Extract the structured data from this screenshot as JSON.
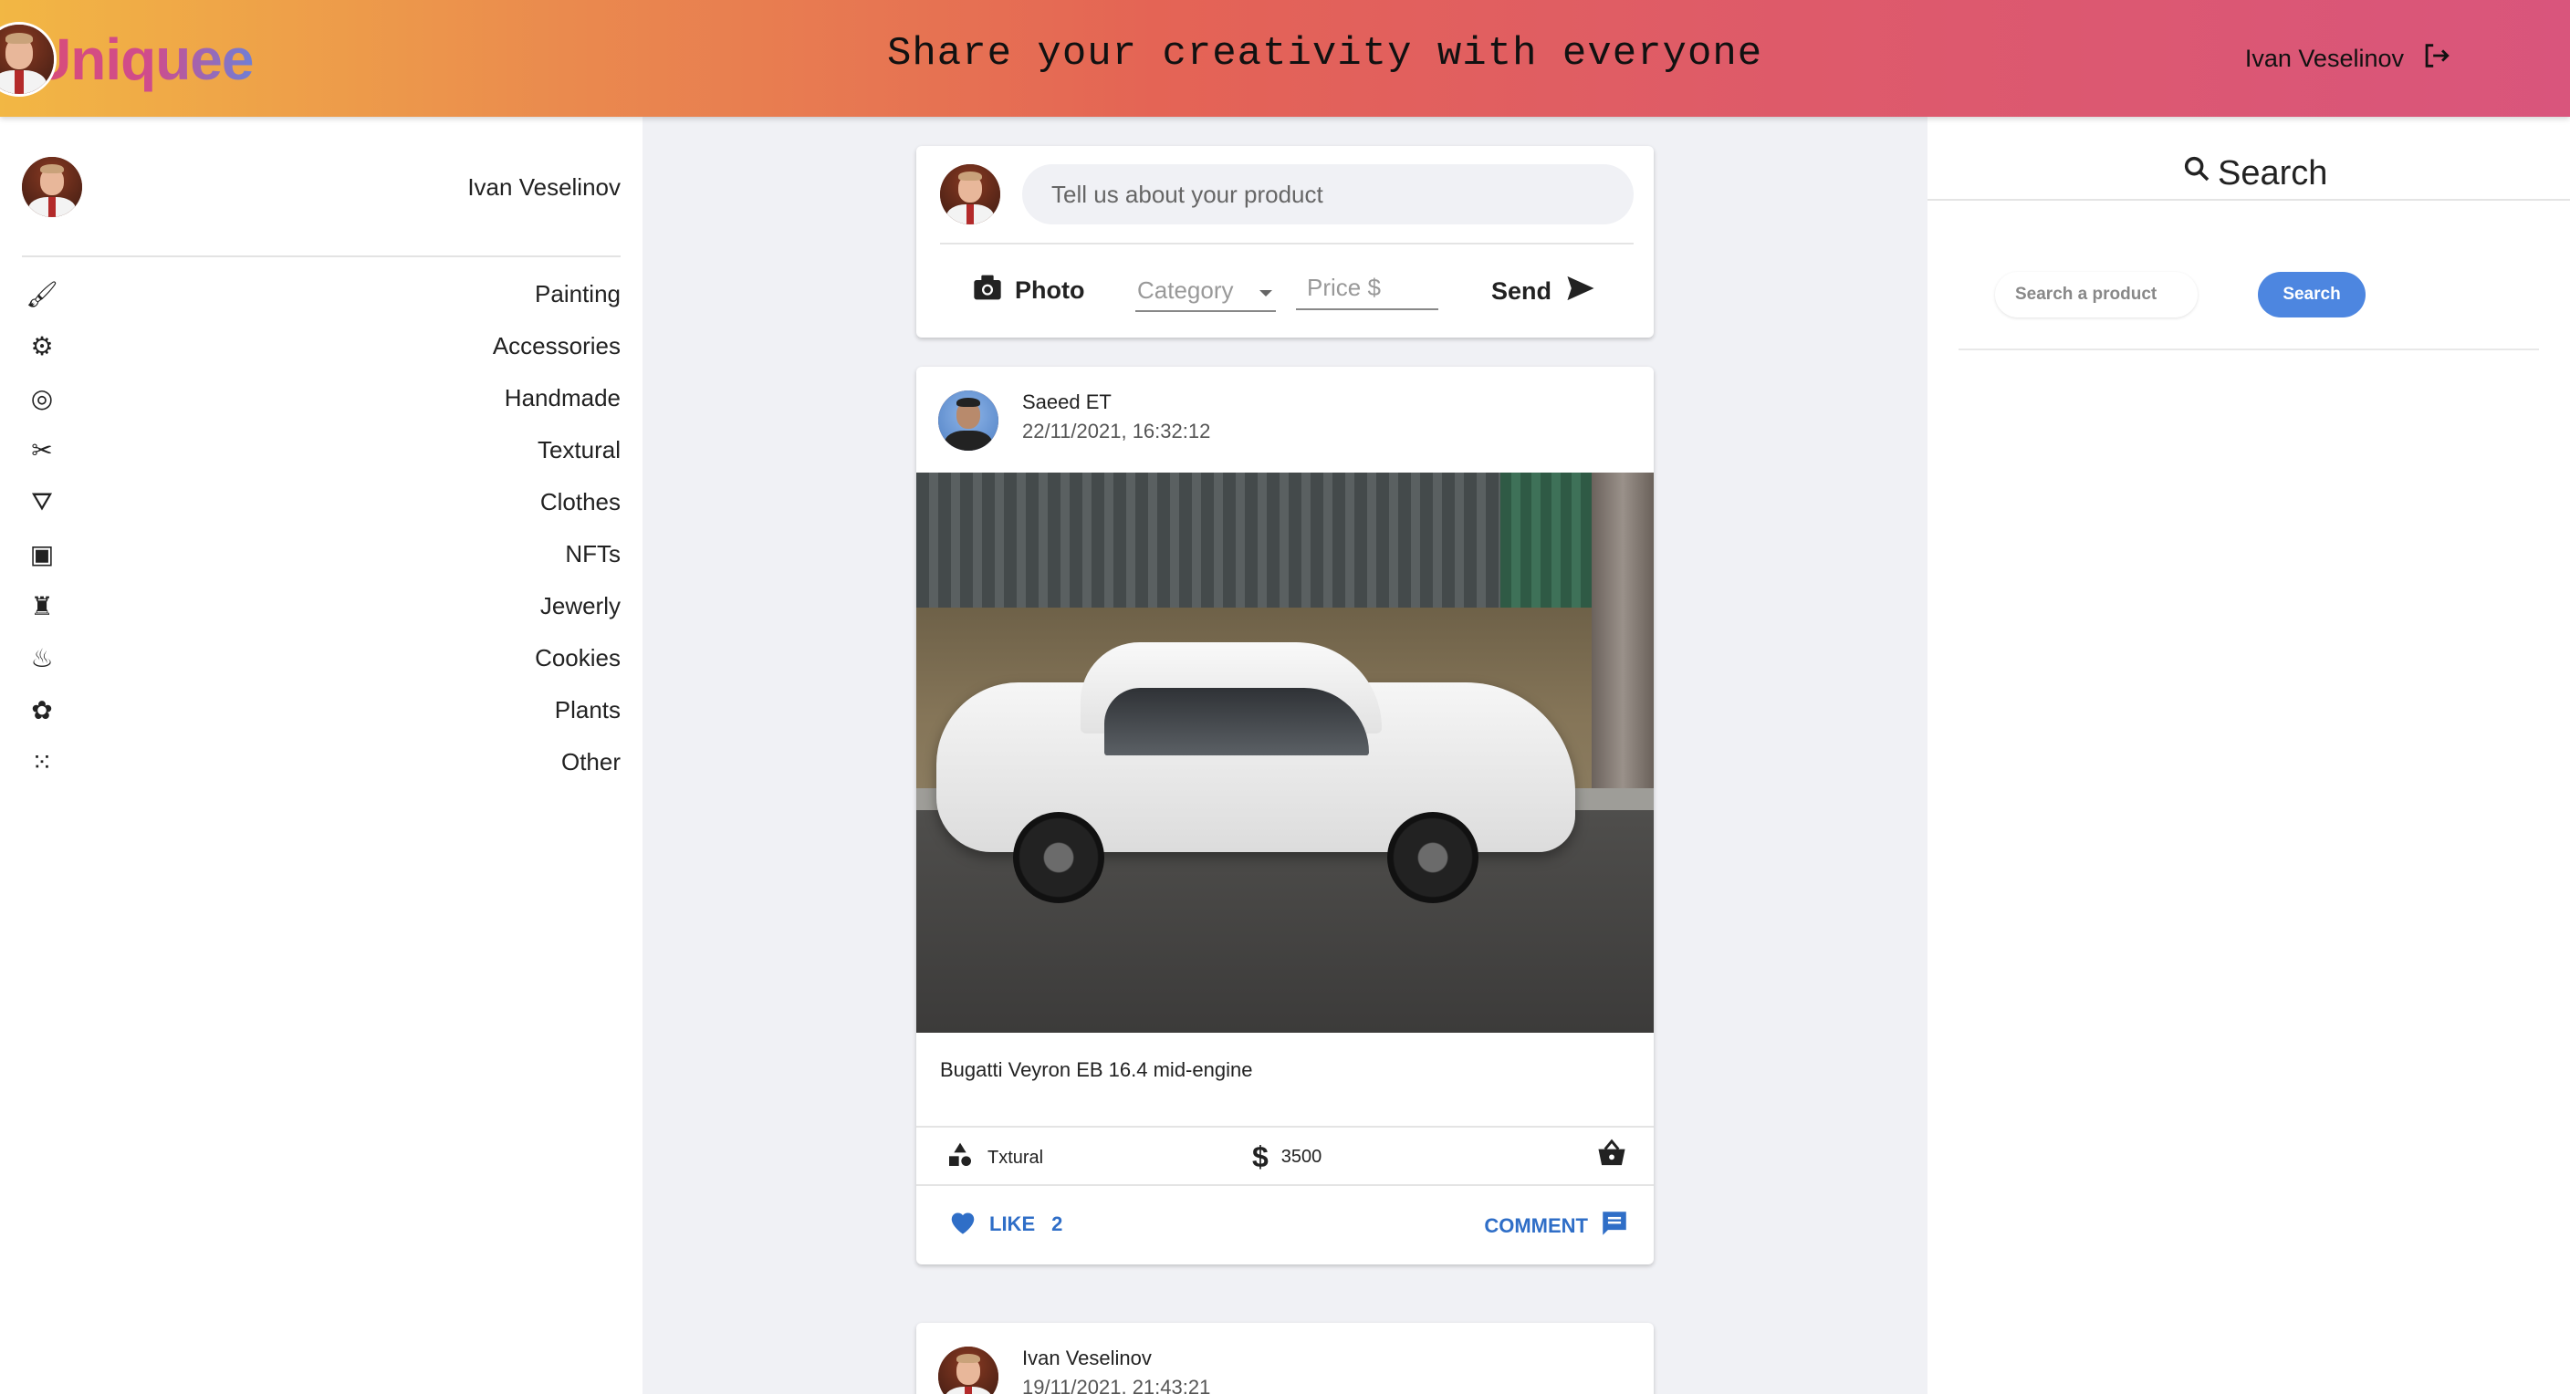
{
  "header": {
    "logo": "Uniquee",
    "tagline": "Share your creativity with everyone",
    "user_name": "Ivan Veselinov",
    "logout_icon": "logout-icon"
  },
  "sidebar": {
    "user_name": "Ivan Veselinov",
    "categories": [
      {
        "label": "Painting",
        "icon": "brush-icon"
      },
      {
        "label": "Accessories",
        "icon": "wheel-icon"
      },
      {
        "label": "Handmade",
        "icon": "fingerprint-icon"
      },
      {
        "label": "Textural",
        "icon": "scissors-icon"
      },
      {
        "label": "Clothes",
        "icon": "hanger-icon"
      },
      {
        "label": "NFTs",
        "icon": "robot-icon"
      },
      {
        "label": "Jewerly",
        "icon": "medal-icon"
      },
      {
        "label": "Cookies",
        "icon": "cake-icon"
      },
      {
        "label": "Plants",
        "icon": "flower-icon"
      },
      {
        "label": "Other",
        "icon": "dots-grid-icon"
      }
    ]
  },
  "composer": {
    "placeholder": "Tell us about your product",
    "photo_label": "Photo",
    "category_placeholder": "Category",
    "price_placeholder": "Price $",
    "send_label": "Send"
  },
  "posts": [
    {
      "author": "Saeed ET",
      "date": "22/11/2021, 16:32:12",
      "description": "Bugatti Veyron EB 16.4 mid-engine",
      "category": "Txtural",
      "price": "3500",
      "like_label": "LIKE",
      "like_count": "2",
      "comment_label": "COMMENT"
    },
    {
      "author": "Ivan Veselinov",
      "date": "19/11/2021, 21:43:21"
    }
  ],
  "search": {
    "title": "Search",
    "placeholder": "Search a product",
    "button_label": "Search"
  },
  "colors": {
    "accent": "#4d86e0",
    "link": "#2f6ec7"
  }
}
